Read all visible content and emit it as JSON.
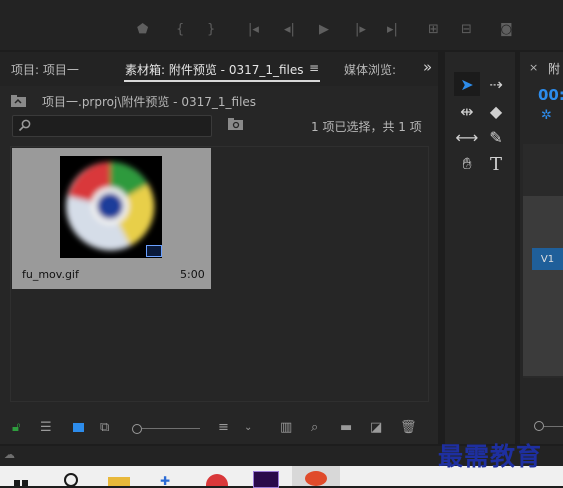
{
  "project_panel": {
    "tabs": [
      {
        "label": "项目: 项目一"
      },
      {
        "label": "素材箱: 附件预览 - 0317_1_files"
      },
      {
        "label": "媒体浏览:"
      }
    ],
    "tab_menu_icon": "≡",
    "overflow_icon": "»",
    "breadcrumb": "项目一.prproj\\附件预览 - 0317_1_files",
    "selection_status": "1 项已选择，共 1 项",
    "item": {
      "name": "fu_mov.gif",
      "duration": "5:00"
    }
  },
  "program_panel": {
    "tab_label": "附",
    "close_icon": "×",
    "timecode": "00:",
    "track_label": "V1"
  },
  "watermark": "最需教育",
  "colors": {
    "accent_blue": "#2d8ceb",
    "track_blue": "#1f5f9a",
    "lock_green": "#2e9e3e",
    "watermark": "#1e2fa0"
  }
}
